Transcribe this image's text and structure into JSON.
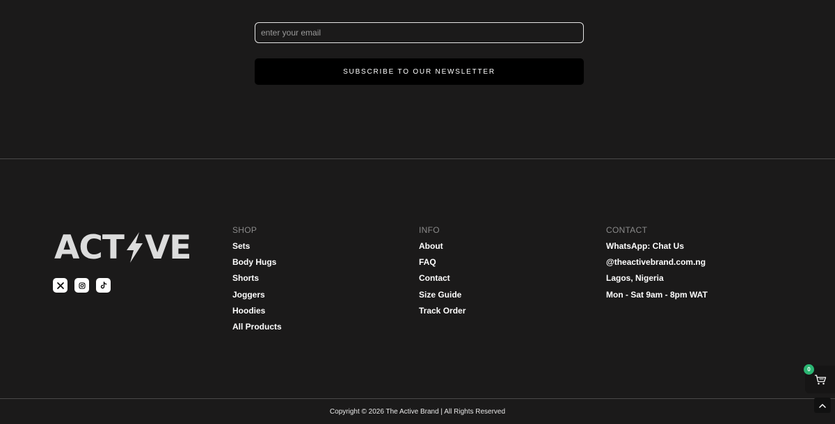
{
  "newsletter": {
    "email_placeholder": "enter your email",
    "email_value": "",
    "subscribe_label": "SUBSCRIBE TO OUR NEWSLETTER"
  },
  "brand": {
    "logo_left": "AC",
    "logo_mid": "T",
    "logo_right": "VE",
    "logo_text": "ACTIVE",
    "logo_color": "#dcdcdc"
  },
  "socials": [
    {
      "icon": "x-twitter-icon"
    },
    {
      "icon": "instagram-icon"
    },
    {
      "icon": "tiktok-icon"
    }
  ],
  "footer": {
    "shop": {
      "heading": "SHOP",
      "links": [
        "Sets",
        "Body Hugs",
        "Shorts",
        "Joggers",
        "Hoodies",
        "All Products"
      ]
    },
    "info": {
      "heading": "INFO",
      "links": [
        "About",
        "FAQ",
        "Contact",
        "Size Guide",
        "Track Order"
      ]
    },
    "contact": {
      "heading": "CONTACT",
      "links": [
        "WhatsApp: Chat Us",
        "@theactivebrand.com.ng",
        "Lagos, Nigeria",
        "Mon - Sat 9am - 8pm WAT"
      ]
    },
    "copyright": "Copyright © 2026 The Active Brand | All Rights Reserved"
  },
  "cart": {
    "count": "0",
    "badge_color": "#2bb673",
    "icon": "cart-icon"
  },
  "scroll_top": {
    "icon": "chevron-up-icon"
  },
  "colors": {
    "background": "#1b1a1a",
    "heading_gray": "#8a8a8a"
  }
}
